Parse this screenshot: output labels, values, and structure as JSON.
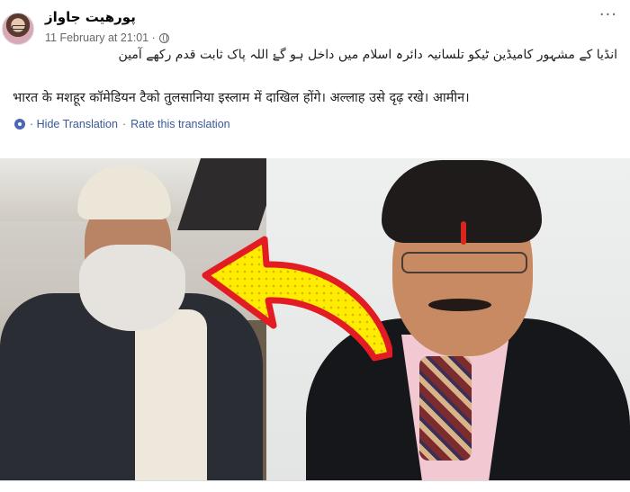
{
  "post": {
    "author": "پورھیت جاواز",
    "timestamp": "11 February at 21:01 ·",
    "more_label": "···",
    "urdu_text": "انڈیا کے مشہور کامیڈین ٹیکو تلسانیہ دائرہ اسلام میں داخل ہو گۓ اللہ پاک ثابت قدم رکھے آمین",
    "hindi_text": "भारत के मशहूर कॉमेडियन टैको तुलसानिया इस्लाम में दाखिल होंगे। अल्लाह उसे दृढ़ रखे। आमीन।",
    "translation": {
      "hide_label": "· Hide Translation",
      "separator": "·",
      "rate_label": "Rate this translation"
    }
  },
  "colors": {
    "link": "#385898",
    "meta": "#65676b",
    "arrow_fill": "#ffec00",
    "arrow_stroke": "#e31b23"
  }
}
